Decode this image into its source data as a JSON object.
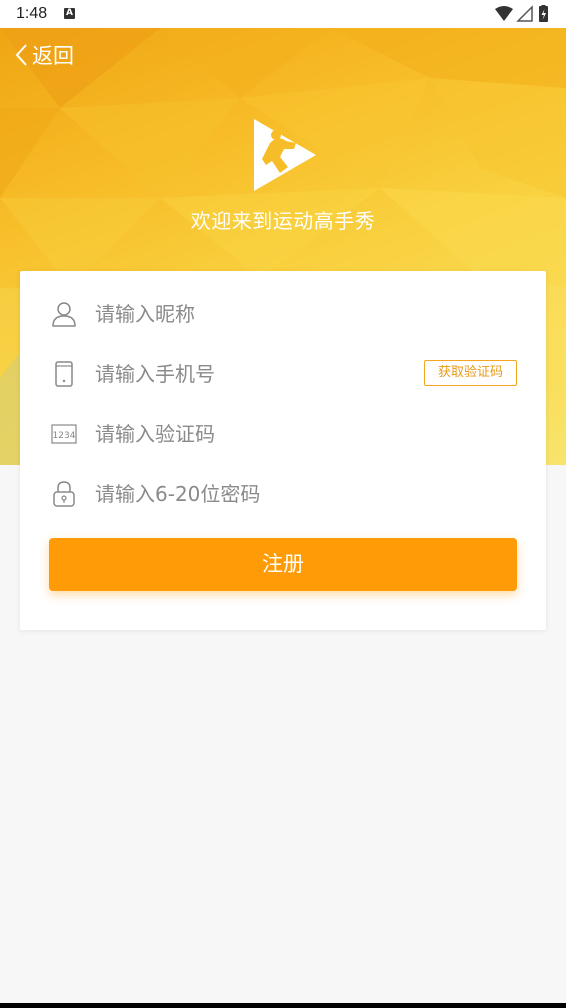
{
  "status_bar": {
    "time": "1:48",
    "notification_icon": "a-icon",
    "icons": [
      "wifi-icon",
      "signal-icon",
      "battery-charging-icon"
    ]
  },
  "header": {
    "back_label": "返回",
    "welcome_text": "欢迎来到运动高手秀",
    "logo": "sport-logo-icon"
  },
  "form": {
    "nickname": {
      "value": "",
      "placeholder": "请输入昵称",
      "icon": "user-icon"
    },
    "phone": {
      "value": "",
      "placeholder": "请输入手机号",
      "icon": "phone-icon"
    },
    "code": {
      "value": "",
      "placeholder": "请输入验证码",
      "icon": "code-1234-icon"
    },
    "password": {
      "value": "",
      "placeholder": "请输入6-20位密码",
      "icon": "lock-icon"
    },
    "get_code_label": "获取验证码",
    "submit_label": "注册"
  },
  "colors": {
    "accent": "#ff9b06",
    "hero_start": "#f0a513",
    "hero_end": "#f8e46d",
    "background": "#f7f7f7"
  }
}
